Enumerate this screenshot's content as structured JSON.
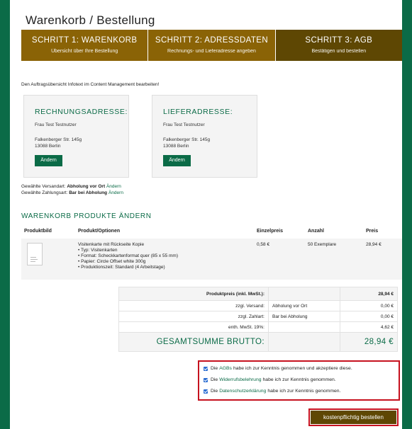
{
  "page": {
    "title": "Warenkorb / Bestellung"
  },
  "steps": [
    {
      "title": "SCHRITT 1: WARENKORB",
      "sub": "Übersicht über Ihre Bestellung",
      "color": "#8a6306"
    },
    {
      "title": "SCHRITT 2: ADRESSDATEN",
      "sub": "Rechnungs- und Lieferadresse angeben",
      "color": "#8a6306"
    },
    {
      "title": "SCHRITT 3: AGB",
      "sub": "Bestätigen und bestellen",
      "color": "#5e4703"
    }
  ],
  "info_text": "Den Auftragsübersicht Infotext im Content Management bearbeiten!",
  "billing": {
    "title": "RECHNUNGSADRESSE:",
    "name": "Frau Test Testnutzer",
    "street": "Falkenberger Str. 145g",
    "city": "13088 Berlin",
    "button": "Ändern"
  },
  "shipping": {
    "title": "LIEFERADRESSE:",
    "name": "Frau Test Testnutzer",
    "street": "Falkenberger Str. 145g",
    "city": "13088 Berlin",
    "button": "Ändern"
  },
  "shipping_method": {
    "label": "Gewählte Versandart:",
    "value": "Abholung vor Ort",
    "link": "Ändern"
  },
  "payment_method": {
    "label": "Gewählte Zahlungsart:",
    "value": "Bar bei Abholung",
    "link": "Ändern"
  },
  "cart": {
    "title": "WARENKORB PRODUKTE ÄNDERN",
    "headers": {
      "image": "Produktbild",
      "product": "Produkt/Optionen",
      "unit_price": "Einzelpreis",
      "qty": "Anzahl",
      "price": "Preis"
    },
    "item": {
      "name": "Visitenkarte mit Rückseite Kopie",
      "options": [
        "Typ: Visitenkarten",
        "Format: Scheckkartenformat quer (85 x 55 mm)",
        "Papier: Circle Offset white 300g",
        "Produktionszeit: Standard (4 Arbeitstage)"
      ],
      "unit_price": "0,58 €",
      "qty": "50 Exemplare",
      "price": "28,94 €"
    }
  },
  "summary": {
    "product_price_label": "Produktpreis (inkl. MwSt.):",
    "product_price": "28,94 €",
    "shipping_label": "zzgl. Versand:",
    "shipping_method": "Abholung vor Ort",
    "shipping_price": "0,00 €",
    "payment_label": "zzgl. Zahlart:",
    "payment_method": "Bar bei Abholung",
    "payment_price": "0,00 €",
    "tax_label": "enth. MwSt. 19%:",
    "tax": "4,62 €",
    "total_label": "GESAMTSUMME BRUTTO:",
    "total": "28,94 €"
  },
  "consents": [
    {
      "pre": "Die",
      "link": "AGBs",
      "post": "habe ich zur Kenntnis genommen und akzeptiere diese."
    },
    {
      "pre": "Die",
      "link": "Widerrufsbelehrung",
      "post": "habe ich zur Kenntnis genommen."
    },
    {
      "pre": "Die",
      "link": "Datenschutzerklärung",
      "post": "habe ich zur Kenntnis genommen."
    }
  ],
  "order_button": "kostenpflichtig bestellen",
  "colors": {
    "brand_green": "#0b6b47",
    "step_brown": "#8a6306",
    "step_dark": "#5e4703",
    "alert_red": "#c6121f"
  }
}
